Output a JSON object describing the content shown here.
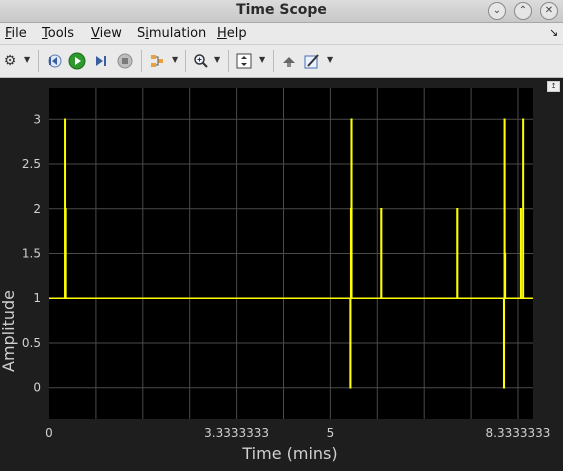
{
  "window": {
    "title": "Time Scope"
  },
  "menu": [
    {
      "label": "File",
      "accel": "F",
      "rest": "ile"
    },
    {
      "label": "Tools",
      "accel": "T",
      "rest": "ools"
    },
    {
      "label": "View",
      "accel": "V",
      "rest": "iew"
    },
    {
      "label": "Simulation",
      "accel": "i",
      "pre": "S",
      "rest": "mulation"
    },
    {
      "label": "Help",
      "accel": "H",
      "rest": "elp"
    }
  ],
  "toolbar": {
    "icons": [
      "settings-icon",
      "step-back-icon",
      "run-icon",
      "step-forward-icon",
      "stop-icon",
      "signal-select-icon",
      "zoom-icon",
      "autoscale-icon",
      "cursor-measure-icon",
      "style-icon"
    ]
  },
  "colors": {
    "plot_bg": "#000000",
    "figure_bg": "#1e1e1e",
    "trace": "#ffff00",
    "grid": "#4a4a4a",
    "axis_text": "#d0d0d0"
  },
  "chart_data": {
    "type": "line",
    "xlabel": "Time (mins)",
    "ylabel": "Amplitude",
    "xlim": [
      0,
      8.6
    ],
    "ylim": [
      -0.35,
      3.35
    ],
    "xticks": [
      0,
      3.3333333,
      5,
      8.3333333
    ],
    "xtick_labels": [
      "0",
      "3.3333333",
      "5",
      "8.3333333"
    ],
    "yticks": [
      0,
      0.5,
      1,
      1.5,
      2,
      2.5,
      3
    ],
    "ytick_labels": [
      "0",
      "0.5",
      "1",
      "1.5",
      "2",
      "2.5",
      "3"
    ],
    "grid": true,
    "series": [
      {
        "x": [
          0,
          0.28,
          0.28,
          0.29,
          0.29,
          0.3,
          0.3,
          5.35,
          5.35,
          5.36,
          5.36,
          5.37,
          5.37,
          5.38,
          5.38,
          5.9,
          5.9,
          5.91,
          5.91,
          7.25,
          7.25,
          7.26,
          7.26,
          8.08,
          8.08,
          8.09,
          8.09,
          8.1,
          8.1,
          8.11,
          8.11,
          8.38,
          8.38,
          8.39,
          8.39,
          8.42,
          8.42,
          8.43,
          8.43,
          8.6
        ],
        "y": [
          1,
          1,
          3,
          3,
          2,
          2,
          1,
          1,
          0,
          0,
          2,
          2,
          3,
          3,
          1,
          1,
          2,
          2,
          1,
          1,
          2,
          2,
          1,
          1,
          0,
          0,
          3,
          3,
          1.5,
          1.5,
          1,
          1,
          2,
          2,
          1,
          1,
          3,
          3,
          1,
          1
        ]
      }
    ]
  }
}
